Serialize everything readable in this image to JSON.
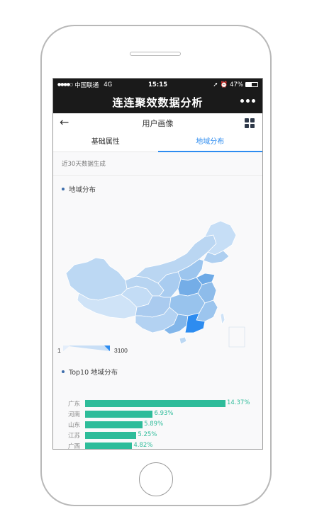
{
  "status_bar": {
    "carrier": "中国联通",
    "network": "4G",
    "time": "15:15",
    "battery": "47%",
    "battery_level": 0.47
  },
  "app": {
    "title": "连连聚效数据分析"
  },
  "nav": {
    "title": "用户画像"
  },
  "tabs": [
    {
      "label": "基础属性",
      "active": false
    },
    {
      "label": "地域分布",
      "active": true
    }
  ],
  "subtitle": "近30天数据生成",
  "map_section": {
    "title": "地域分布",
    "legend_min": "1",
    "legend_max": "3100"
  },
  "top_section": {
    "title": "Top10 地域分布"
  },
  "chart_data": {
    "type": "bar",
    "categories": [
      "广东",
      "河南",
      "山东",
      "江苏",
      "广西"
    ],
    "values": [
      14.37,
      6.93,
      5.89,
      5.25,
      4.82
    ],
    "value_labels": [
      "14.37%",
      "6.93%",
      "5.89%",
      "5.25%",
      "4.82%"
    ],
    "color": "#2ebc9a"
  },
  "colors": {
    "accent": "#2d8cf0",
    "dark_bar": "#1a1a1a",
    "bar": "#2ebc9a"
  }
}
